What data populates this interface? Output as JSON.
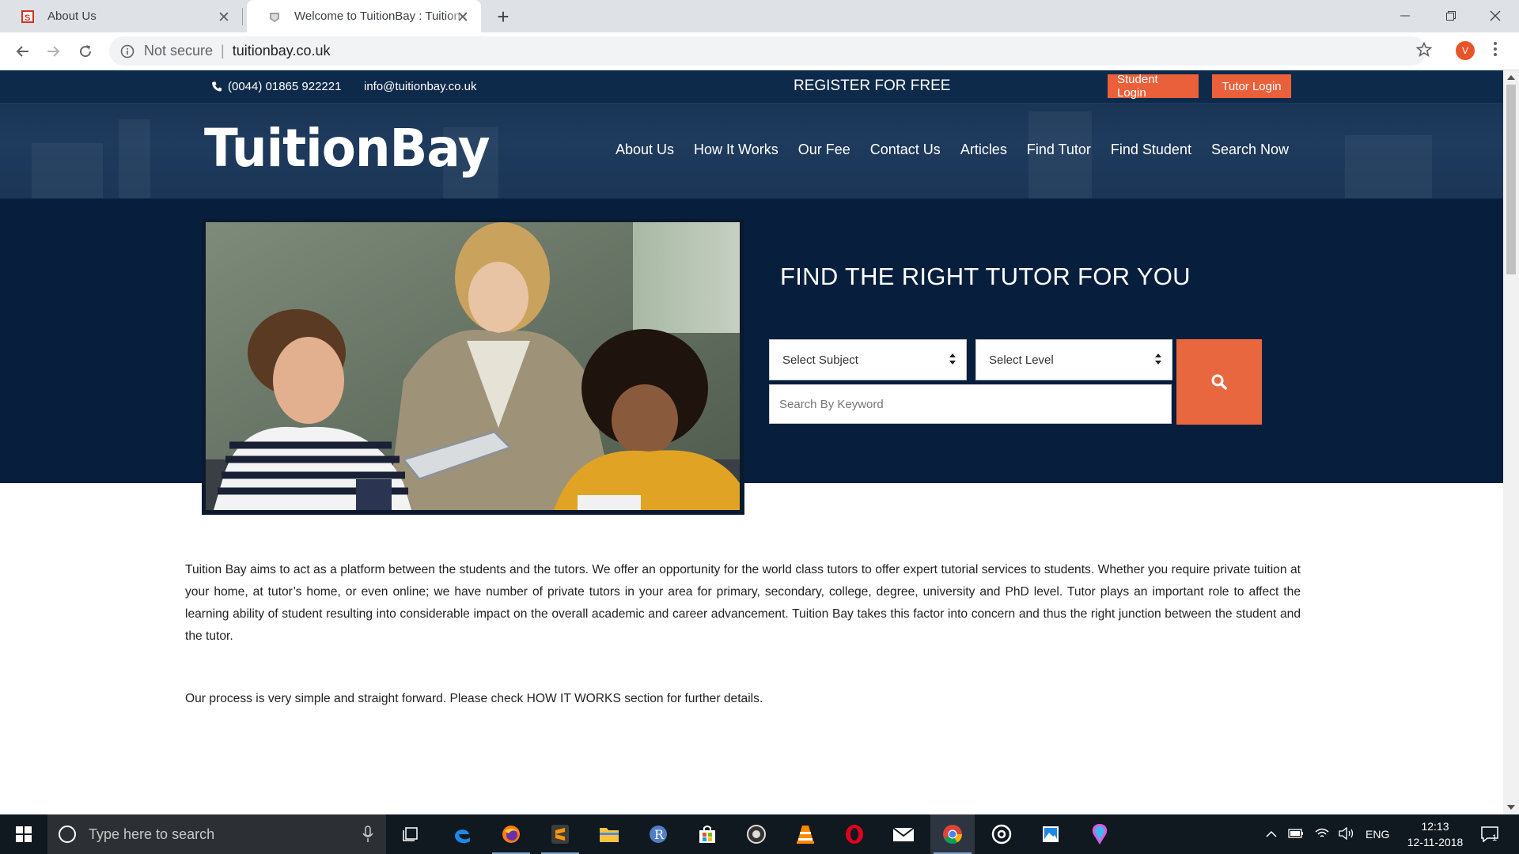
{
  "browser": {
    "tabs": [
      {
        "title": "About Us",
        "active": false
      },
      {
        "title": "Welcome to TuitionBay : Tuition Bay",
        "active": true
      }
    ],
    "address": {
      "security": "Not secure",
      "url": "tuitionbay.co.uk"
    },
    "profile_initial": "V"
  },
  "site": {
    "topbar": {
      "phone": "(0044) 01865 922221",
      "email": "info@tuitionbay.co.uk",
      "register": "REGISTER FOR FREE",
      "student_login": "Student Login",
      "tutor_login": "Tutor Login"
    },
    "logo": "TuitionBay",
    "nav": [
      "About Us",
      "How It Works",
      "Our Fee",
      "Contact Us",
      "Articles",
      "Find Tutor",
      "Find Student",
      "Search Now"
    ],
    "hero": {
      "title": "FIND THE RIGHT TUTOR FOR YOU",
      "subject_select": "Select Subject",
      "level_select": "Select Level",
      "keyword_placeholder": "Search By Keyword"
    },
    "intro": "Tuition Bay aims to act as a platform between the students and the tutors. We offer an opportunity for the world class tutors to offer expert tutorial services to students. Whether you require private tuition at your home, at tutor’s home, or even online; we have number of private tutors in your area for primary, secondary, college, degree, university and PhD level. Tutor plays an important role to affect the learning ability of student resulting into considerable impact on the overall academic and career advancement. Tuition Bay takes this factor into concern and thus the right junction between the student and the tutor.",
    "process": "Our process is very simple and straight forward. Please check HOW IT WORKS section for further details."
  },
  "colors": {
    "accent": "#e9603a",
    "navy": "#0e2a4a",
    "hero_bg": "#071f3d"
  },
  "taskbar": {
    "search_placeholder": "Type here to search",
    "language": "ENG",
    "time": "12:13",
    "date": "12-11-2018",
    "notifications": "1",
    "apps": [
      "task-view-icon",
      "edge-icon",
      "firefox-icon",
      "sublime-icon",
      "file-explorer-icon",
      "r-icon",
      "store-icon",
      "camera-icon",
      "vlc-icon",
      "opera-icon",
      "mail-icon",
      "chrome-icon",
      "groove-icon",
      "photos-icon",
      "paint3d-icon"
    ]
  }
}
